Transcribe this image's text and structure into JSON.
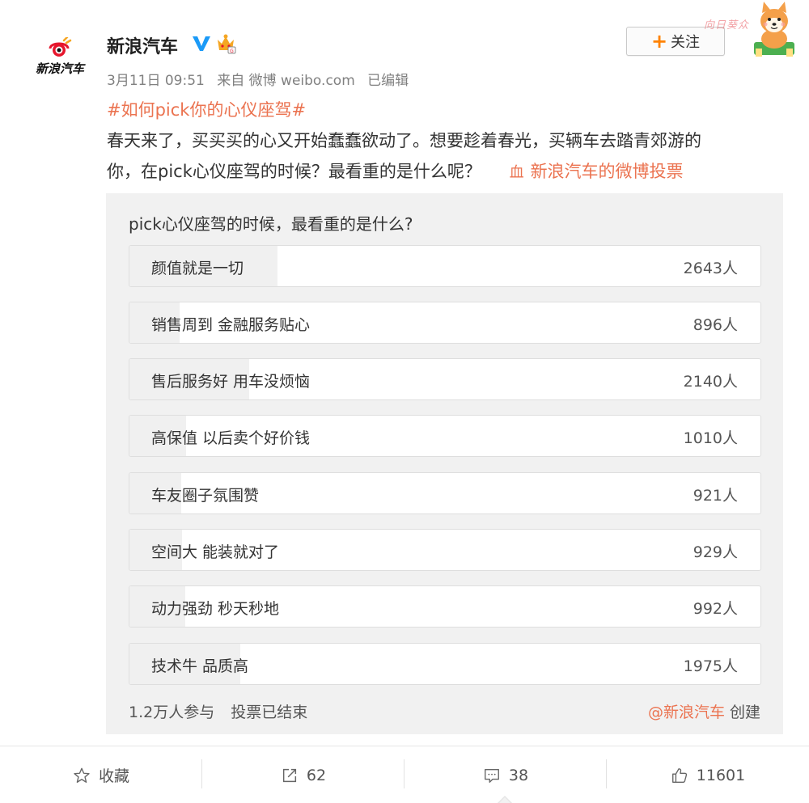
{
  "user": {
    "name": "新浪汽车",
    "logo_text": "新浪汽车"
  },
  "follow_label": "关注",
  "follow_plus": "+",
  "mascot_text": "向日葵众",
  "meta": {
    "date": "3月11日 09:51",
    "source": "来自 微博 weibo.com",
    "edited": "已编辑"
  },
  "post": {
    "hashtag": "#如何pick你的心仪座驾#",
    "line1": "春天来了，买买买的心又开始蠢蠢欲动了。想要趁着春光，买辆车去踏青郊游的",
    "line2": "你，在pick心仪座驾的时候？最看重的是什么呢？",
    "vote_link": "新浪汽车的微博投票",
    "vote_link_icon": "血"
  },
  "poll": {
    "title": "pick心仪座驾的时候，最看重的是什么?",
    "options": [
      {
        "label": "颜值就是一切",
        "count": "2643人",
        "share": 0.235
      },
      {
        "label": "销售周到 金融服务贴心",
        "count": "896人",
        "share": 0.08
      },
      {
        "label": "售后服务好 用车没烦恼",
        "count": "2140人",
        "share": 0.19
      },
      {
        "label": "高保值 以后卖个好价钱",
        "count": "1010人",
        "share": 0.09
      },
      {
        "label": "车友圈子氛围赞",
        "count": "921人",
        "share": 0.082
      },
      {
        "label": "空间大 能装就对了",
        "count": "929人",
        "share": 0.083
      },
      {
        "label": "动力强劲 秒天秒地",
        "count": "992人",
        "share": 0.088
      },
      {
        "label": "技术牛 品质高",
        "count": "1975人",
        "share": 0.176
      }
    ],
    "participants": "1.2万人参与",
    "status": "投票已结束",
    "creator": "@新浪汽车",
    "created_label": "创建"
  },
  "actions": {
    "favorite": "收藏",
    "repost": "62",
    "comment": "38",
    "like": "11601"
  },
  "colors": {
    "accent": "#eb7350",
    "follow_plus": "#ff8200",
    "verified": "#1b9af7"
  }
}
